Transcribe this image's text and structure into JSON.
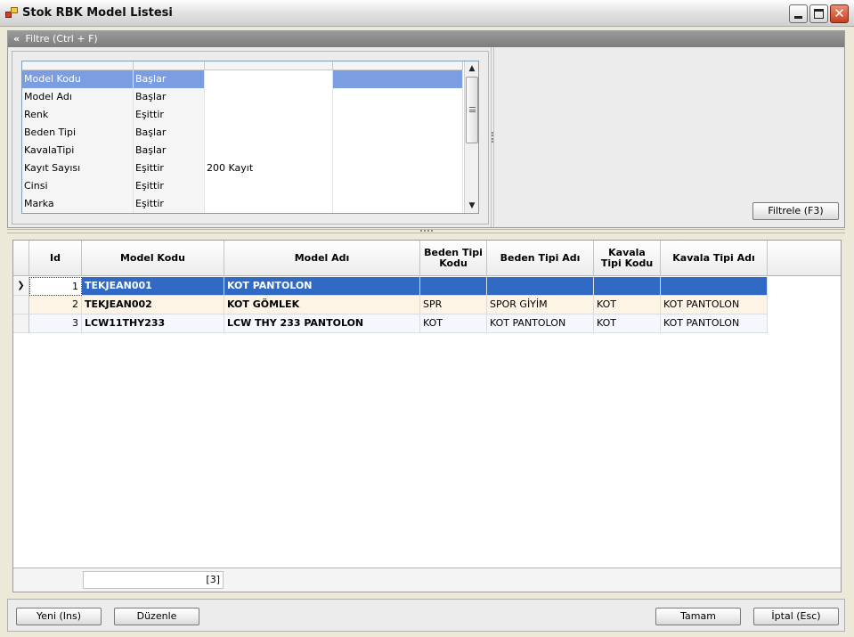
{
  "window": {
    "title": "Stok RBK Model Listesi",
    "close_glyph": "✕"
  },
  "filter": {
    "header": "Filtre (Ctrl + F)",
    "header_icon": "double-chevron-up-icon",
    "rows": [
      {
        "field": "Model Kodu",
        "op": "Başlar",
        "value": "",
        "extra": ""
      },
      {
        "field": "Model Adı",
        "op": "Başlar",
        "value": "",
        "extra": ""
      },
      {
        "field": "Renk",
        "op": "Eşittir",
        "value": "",
        "extra": ""
      },
      {
        "field": "Beden Tipi",
        "op": "Başlar",
        "value": "",
        "extra": ""
      },
      {
        "field": "KavalaTipi",
        "op": "Başlar",
        "value": "",
        "extra": ""
      },
      {
        "field": "Kayıt Sayısı",
        "op": "Eşittir",
        "value": "200 Kayıt",
        "extra": ""
      },
      {
        "field": "Cinsi",
        "op": "Eşittir",
        "value": "",
        "extra": ""
      },
      {
        "field": "Marka",
        "op": "Eşittir",
        "value": "",
        "extra": ""
      }
    ],
    "apply_button": "Filtrele (F3)"
  },
  "grid": {
    "columns": [
      {
        "key": "id",
        "label": "Id"
      },
      {
        "key": "model_kodu",
        "label": "Model Kodu"
      },
      {
        "key": "model_adi",
        "label": "Model Adı"
      },
      {
        "key": "beden_tipi_kodu",
        "label": "Beden Tipi Kodu"
      },
      {
        "key": "beden_tipi_adi",
        "label": "Beden Tipi Adı"
      },
      {
        "key": "kavala_tipi_kodu",
        "label": "Kavala Tipi Kodu"
      },
      {
        "key": "kavala_tipi_adi",
        "label": "Kavala Tipi Adı"
      }
    ],
    "rows": [
      {
        "id": "1",
        "model_kodu": "TEKJEAN001",
        "model_adi": "KOT PANTOLON",
        "beden_tipi_kodu": "",
        "beden_tipi_adi": "",
        "kavala_tipi_kodu": "",
        "kavala_tipi_adi": ""
      },
      {
        "id": "2",
        "model_kodu": "TEKJEAN002",
        "model_adi": "KOT GÖMLEK",
        "beden_tipi_kodu": "SPR",
        "beden_tipi_adi": "SPOR GİYİM",
        "kavala_tipi_kodu": "KOT",
        "kavala_tipi_adi": "KOT PANTOLON"
      },
      {
        "id": "3",
        "model_kodu": "LCW11THY233",
        "model_adi": "LCW THY 233 PANTOLON",
        "beden_tipi_kodu": "KOT",
        "beden_tipi_adi": "KOT PANTOLON",
        "kavala_tipi_kodu": "KOT",
        "kavala_tipi_adi": "KOT PANTOLON"
      }
    ],
    "row_indicator": "❯",
    "footer_count": "[3]"
  },
  "buttons": {
    "new": "Yeni (Ins)",
    "edit": "Düzenle",
    "ok": "Tamam",
    "cancel": "İptal (Esc)"
  }
}
